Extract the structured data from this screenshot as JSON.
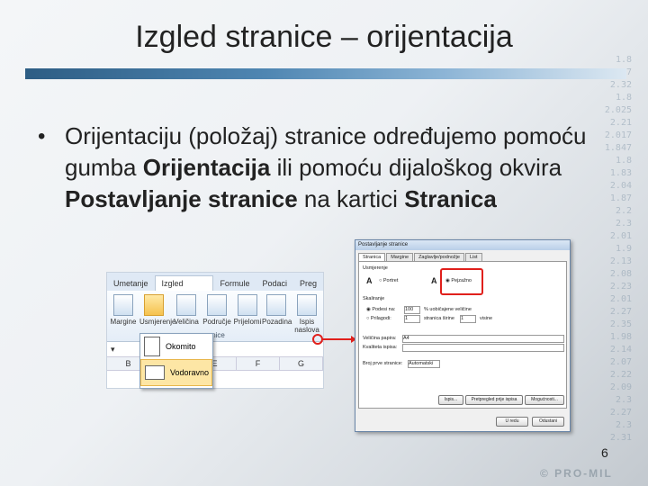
{
  "slide": {
    "title": "Izgled stranice – orijentacija",
    "bullet_part1": "Orijentaciju (položaj) stranice određujemo pomoću gumba ",
    "bullet_b1": "Orijentacija",
    "bullet_part2": " ili pomoću dijaloškog okvira ",
    "bullet_b2": "Postavljanje stranice",
    "bullet_part3": " na kartici ",
    "bullet_b3": "Stranica",
    "page_number": "6",
    "logo": "© PRO-MIL"
  },
  "background_numbers": [
    "1.8",
    "1.77",
    "2.32",
    "1.8",
    "2.025",
    "2.21",
    "2.017",
    "1.847",
    "1.8",
    "1.83",
    "2.04",
    "1.87",
    "2.2",
    "2.3",
    "2.01",
    "1.9",
    "2.13",
    "2.08",
    "2.23",
    "2.01",
    "2.27",
    "2.35",
    "1.98",
    "2.14",
    "2.07",
    "2.22",
    "2.09",
    "2.3",
    "2.27",
    "2.3",
    "2.31"
  ],
  "ribbon": {
    "tabs": [
      "Umetanje",
      "Izgled stranice",
      "Formule",
      "Podaci",
      "Preg"
    ],
    "active_tab": "Izgled stranice",
    "buttons": [
      "Margine",
      "Usmjerenje",
      "Veličina",
      "Područje",
      "Prijelomi",
      "Pozadina",
      "Ispis naslova"
    ],
    "group_label": "ranice",
    "columns": [
      "B",
      "",
      "E",
      "F",
      "G"
    ],
    "menu_items": [
      "Okomito",
      "Vodoravno"
    ]
  },
  "dialog": {
    "title": "Postavljanje stranice",
    "help": "?",
    "tabs": [
      "Stranica",
      "Margine",
      "Zaglavlje/podnožje",
      "List"
    ],
    "orientation_label": "Usmjerenje",
    "portrait": "Portret",
    "landscape": "Pejzažno",
    "scaling_label": "Skaliranje",
    "adjust_to": "Podesi na:",
    "adjust_value": "100",
    "adjust_suffix": "% uobičajene veličine",
    "fit_to": "Prilagodi:",
    "fit_pages": "1",
    "fit_wide": "stranica širine",
    "fit_tall_value": "1",
    "fit_tall": "visine",
    "paper_size_label": "Veličina papira:",
    "paper_size_value": "A4",
    "print_quality_label": "Kvaliteta ispisa:",
    "first_page_label": "Broj prve stranice:",
    "first_page_value": "Automatski",
    "btn_print": "Ispis...",
    "btn_preview": "Pretpregled prije ispisa",
    "btn_options": "Mogućnosti...",
    "btn_ok": "U redu",
    "btn_cancel": "Odustani"
  },
  "colors": {
    "rule_start": "#2d5d84",
    "highlight_red": "#e0201c"
  }
}
